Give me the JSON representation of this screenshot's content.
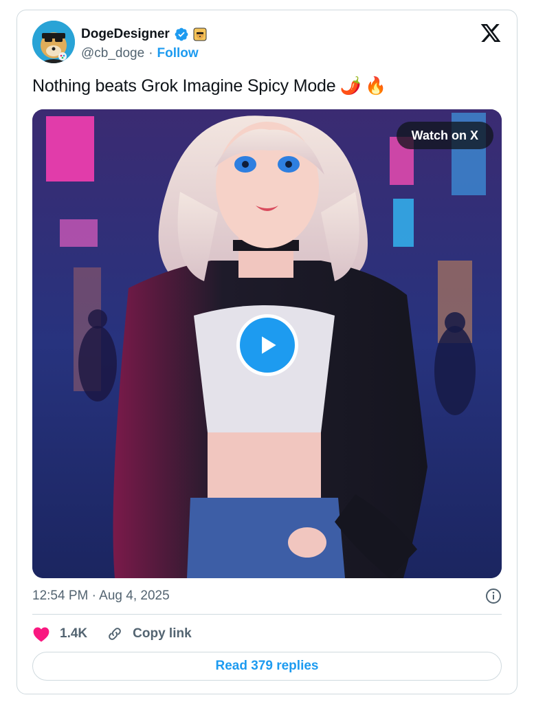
{
  "author": {
    "display_name": "DogeDesigner",
    "handle": "@cb_doge",
    "separator": "·",
    "follow_label": "Follow",
    "verified_icon": "verified-badge-icon",
    "badge_icon": "doge-emoji-icon"
  },
  "tweet": {
    "text": "Nothing beats Grok Imagine Spicy Mode",
    "emojis": [
      "🌶️",
      "🔥"
    ]
  },
  "media": {
    "watch_label": "Watch on X",
    "play_icon": "play-icon",
    "description": "anime-style illustration"
  },
  "meta": {
    "timestamp": "12:54 PM · Aug 4, 2025",
    "info_icon": "info-icon"
  },
  "actions": {
    "likes_count": "1.4K",
    "copy_link_label": "Copy link"
  },
  "replies_button_label": "Read 379 replies",
  "colors": {
    "accent": "#1d9bf0",
    "like": "#f91880",
    "text_primary": "#0f1419",
    "text_secondary": "#536471",
    "border": "#cfd9de"
  }
}
